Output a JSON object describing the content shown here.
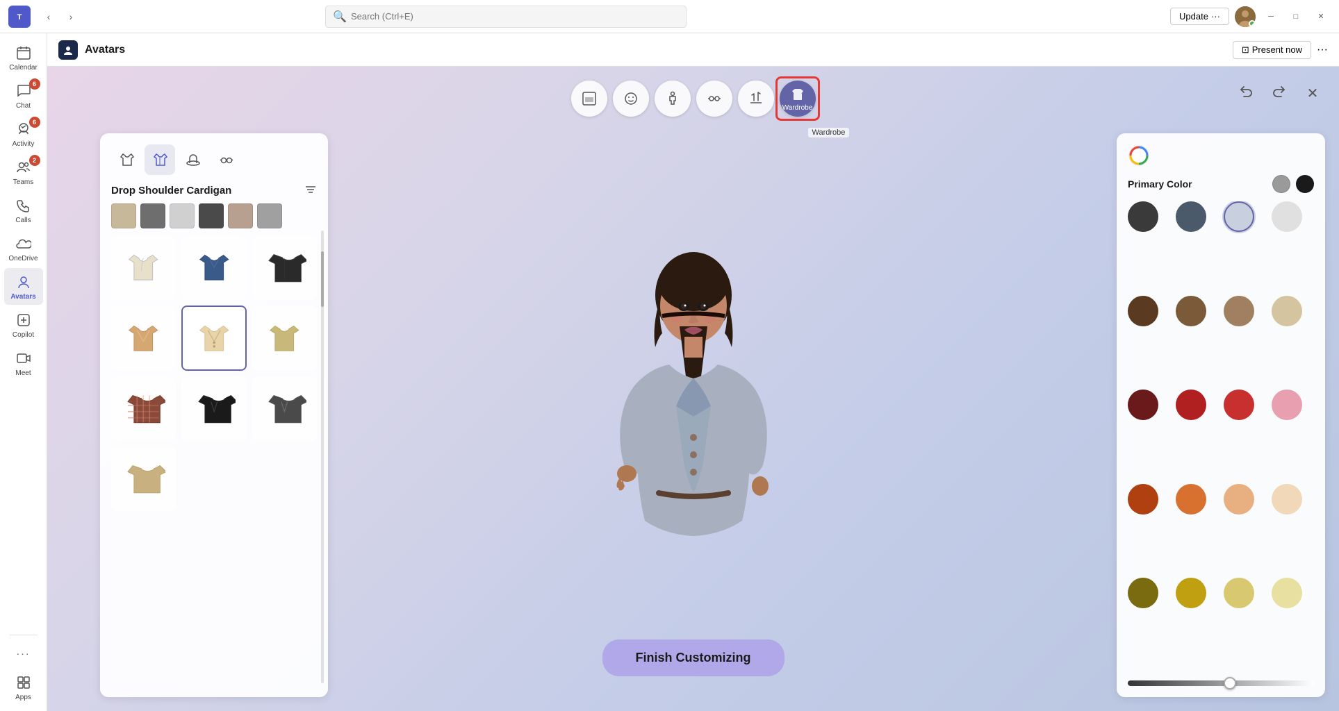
{
  "titleBar": {
    "searchPlaceholder": "Search (Ctrl+E)",
    "updateLabel": "Update",
    "updateDots": "···",
    "minimizeLabel": "─",
    "maximizeLabel": "□",
    "closeLabel": "✕"
  },
  "sidebar": {
    "items": [
      {
        "id": "calendar",
        "label": "Calendar",
        "icon": "📅",
        "badge": null
      },
      {
        "id": "chat",
        "label": "Chat",
        "icon": "💬",
        "badge": "6"
      },
      {
        "id": "activity",
        "label": "Activity",
        "icon": "🔔",
        "badge": "6"
      },
      {
        "id": "teams",
        "label": "Teams",
        "icon": "👥",
        "badge": "2"
      },
      {
        "id": "calls",
        "label": "Calls",
        "icon": "📞",
        "badge": null
      },
      {
        "id": "onedrive",
        "label": "OneDrive",
        "icon": "☁",
        "badge": null
      },
      {
        "id": "avatars",
        "label": "Avatars",
        "icon": "👤",
        "badge": null,
        "active": true
      },
      {
        "id": "copilot",
        "label": "Copilot",
        "icon": "⚙",
        "badge": null
      },
      {
        "id": "meet",
        "label": "Meet",
        "icon": "📹",
        "badge": null
      },
      {
        "id": "more",
        "label": "···",
        "icon": "···",
        "badge": null
      },
      {
        "id": "apps",
        "label": "Apps",
        "icon": "⊞",
        "badge": null
      }
    ]
  },
  "appHeader": {
    "iconLabel": "A",
    "title": "Avatars",
    "presentNow": "Present now",
    "moreOptions": "···"
  },
  "editorToolbar": {
    "buttons": [
      {
        "id": "pose",
        "icon": "⊟",
        "label": ""
      },
      {
        "id": "face",
        "icon": "😐",
        "label": ""
      },
      {
        "id": "body",
        "icon": "🧍",
        "label": ""
      },
      {
        "id": "accessories",
        "icon": "👓",
        "label": ""
      },
      {
        "id": "reactions",
        "icon": "✋",
        "label": ""
      },
      {
        "id": "wardrobe",
        "icon": "👕",
        "label": "Wardrobe",
        "active": true
      }
    ],
    "undoLabel": "↩",
    "redoLabel": "↪",
    "closeLabel": "✕"
  },
  "wardrobePanel": {
    "tabs": [
      {
        "id": "shirt",
        "icon": "👔",
        "label": ""
      },
      {
        "id": "cardigan",
        "icon": "🧥",
        "label": "",
        "active": true
      },
      {
        "id": "hat",
        "icon": "🎩",
        "label": ""
      },
      {
        "id": "glasses",
        "icon": "👓",
        "label": ""
      }
    ],
    "title": "Drop Shoulder Cardigan",
    "filterIcon": "≡",
    "scrollbarPresent": true,
    "colorThumbs": [
      "#c8b89a",
      "#6e6e6e",
      "#d0d0d0",
      "#4a4a4a",
      "#b8a090",
      "#a0a0a0"
    ],
    "clothingItems": [
      {
        "id": 1,
        "color": "#e8e0c8",
        "type": "hoodie",
        "selected": false
      },
      {
        "id": 2,
        "color": "#3a5a8a",
        "type": "jacket",
        "selected": false
      },
      {
        "id": 3,
        "color": "#2a2a2a",
        "type": "coat",
        "selected": false
      },
      {
        "id": 4,
        "color": "#d4a870",
        "type": "cardigan-orange",
        "selected": false
      },
      {
        "id": 5,
        "color": "#e8d4a8",
        "type": "cardigan-beige",
        "selected": true
      },
      {
        "id": 6,
        "color": "#c8b87a",
        "type": "jacket-tan",
        "selected": false
      },
      {
        "id": 7,
        "color": "#8a4a3a",
        "type": "plaid",
        "selected": false
      },
      {
        "id": 8,
        "color": "#1a1a1a",
        "type": "blazer-black",
        "selected": false
      },
      {
        "id": 9,
        "color": "#4a4a4a",
        "type": "blazer-gray",
        "selected": false
      },
      {
        "id": 10,
        "color": "#c8b080",
        "type": "coat-tan",
        "selected": false
      }
    ]
  },
  "colorPanel": {
    "title": "Primary Color",
    "primarySwatches": [
      {
        "color": "#9a9a9a",
        "selected": false
      },
      {
        "color": "#1a1a1a",
        "selected": false
      }
    ],
    "colors": [
      {
        "hex": "#3a3a3a",
        "row": 0,
        "selected": false
      },
      {
        "hex": "#4a5a6a",
        "row": 0,
        "selected": false
      },
      {
        "hex": "#c8d0e0",
        "row": 0,
        "selected": true
      },
      {
        "hex": "#e0e0e0",
        "row": 0,
        "selected": false
      },
      {
        "hex": "#5a3a20",
        "row": 1,
        "selected": false
      },
      {
        "hex": "#7a5a38",
        "row": 1,
        "selected": false
      },
      {
        "hex": "#a08060",
        "row": 1,
        "selected": false
      },
      {
        "hex": "#d4c4a0",
        "row": 1,
        "selected": false
      },
      {
        "hex": "#6a1a1a",
        "row": 2,
        "selected": false
      },
      {
        "hex": "#b02020",
        "row": 2,
        "selected": false
      },
      {
        "hex": "#c83030",
        "row": 2,
        "selected": false
      },
      {
        "hex": "#e8a0b0",
        "row": 2,
        "selected": false
      },
      {
        "hex": "#b04010",
        "row": 3,
        "selected": false
      },
      {
        "hex": "#d87030",
        "row": 3,
        "selected": false
      },
      {
        "hex": "#e8b080",
        "row": 3,
        "selected": false
      },
      {
        "hex": "#f0d8b8",
        "row": 3,
        "selected": false
      },
      {
        "hex": "#7a6a10",
        "row": 4,
        "selected": false
      },
      {
        "hex": "#c0a010",
        "row": 4,
        "selected": false
      },
      {
        "hex": "#d8c870",
        "row": 4,
        "selected": false
      },
      {
        "hex": "#e8e0a0",
        "row": 4,
        "selected": false
      }
    ],
    "brightnessThumbPosition": "55%"
  },
  "finishButton": {
    "label": "Finish Customizing"
  }
}
